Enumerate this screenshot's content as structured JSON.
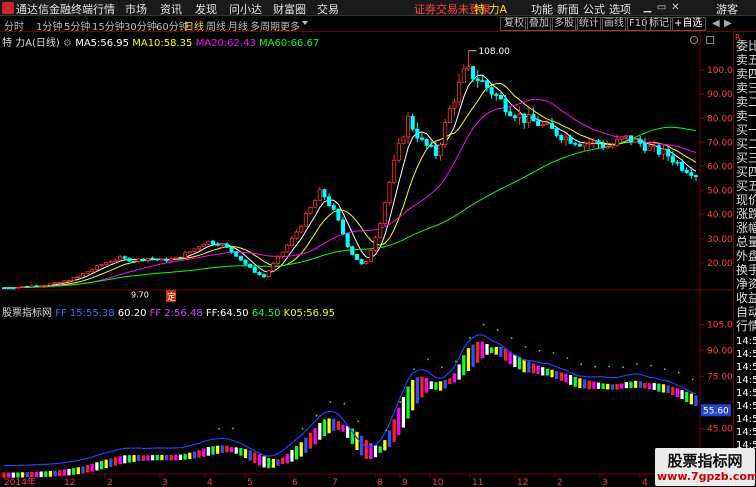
{
  "menubar": {
    "app_title": "通达信金融终端",
    "items": [
      "行情",
      "市场",
      "资讯",
      "发现",
      "问小达",
      "财富圈",
      "交易"
    ],
    "notice": "证劵交易未登录",
    "notice_stock": "特 力A",
    "right_items": [
      "功能",
      "新面",
      "公式",
      "选项"
    ],
    "guest": "游客"
  },
  "periodbar": {
    "periods": [
      "分时",
      "1分钟",
      "5分钟",
      "15分钟",
      "30分钟",
      "60分钟",
      "日线",
      "周线",
      "月线",
      "多周期",
      "更多"
    ],
    "active_period": "日线",
    "tools": [
      "复权",
      "叠加",
      "多股",
      "统计",
      "画线",
      "F10",
      "标记"
    ],
    "self_select": "+自选"
  },
  "main_legend": {
    "name": "特 力A",
    "period": "(日线)",
    "ma5_label": "MA5:",
    "ma5": "56.95",
    "ma10_label": "MA10:",
    "ma10": "58.35",
    "ma20_label": "MA20:",
    "ma20": "62.43",
    "ma60_label": "MA60:",
    "ma60": "66.67"
  },
  "indicator_legend": {
    "name": "股票指标网",
    "fa_label": "FF 15:",
    "fa": "55.38",
    "v1": "60.20",
    "fb_label": "FF 2:",
    "fb": "56.48",
    "ff_label": "FF:",
    "ff": "64.50",
    "v2": "64.50",
    "k05_label": "K05:",
    "k05": "56.95"
  },
  "axis": {
    "main_ticks": [
      "100.0",
      "90.00",
      "80.00",
      "70.00",
      "60.00",
      "50.00",
      "40.00",
      "30.00",
      "20.00"
    ],
    "ind_ticks": [
      "105.0",
      "90.00",
      "75.00",
      "55.60",
      "45.00",
      "30.00"
    ],
    "current_ind": "55.60",
    "peak_label": "108.00",
    "low_label": "9.70",
    "event_marker": "定",
    "date_ticks": [
      "2014年",
      "12",
      "2",
      "3",
      "4",
      "5",
      "6",
      "7",
      "8",
      "9",
      "10",
      "11",
      "12",
      "2",
      "3",
      "4"
    ]
  },
  "right_panel": {
    "top_badge": "R",
    "labels": [
      "委比",
      "卖五",
      "卖四",
      "卖三",
      "卖二",
      "卖一",
      "买一",
      "买二",
      "买三",
      "买四",
      "买五",
      "现价",
      "涨跌",
      "涨幅",
      "总量",
      "外盘",
      "换手",
      "净资",
      "收益",
      "自动",
      "行情"
    ],
    "times": [
      "14:56",
      "14:56",
      "14:56",
      "14:56",
      "14:56",
      "14:56",
      "14:56",
      "14:56",
      "14:56"
    ]
  },
  "watermark": {
    "title": "股票指标网",
    "url": "www.7gpzb.com"
  },
  "colors": {
    "up": "#ff3030",
    "down": "#00ffff",
    "ma5": "#ffffff",
    "ma10": "#ffff00",
    "ma20": "#ff00ff",
    "ma60": "#00ff00",
    "axis": "#7a0000"
  },
  "chart_data": {
    "type": "candlestick",
    "title": "特 力A (日线)",
    "ylim": [
      10,
      110
    ],
    "x": [
      "2014年",
      "12",
      "2",
      "3",
      "4",
      "5",
      "6",
      "7",
      "8",
      "9",
      "10",
      "11",
      "12",
      "2",
      "3",
      "4"
    ],
    "close": [
      9.7,
      10,
      10.5,
      11,
      12,
      14,
      17,
      20,
      22,
      21,
      22,
      21,
      22,
      25,
      29,
      28,
      24,
      18,
      14,
      22,
      30,
      40,
      50,
      40,
      25,
      18,
      35,
      60,
      80,
      70,
      65,
      85,
      100,
      96,
      90,
      84,
      80,
      78,
      75,
      72,
      70,
      70,
      68,
      72,
      70,
      67,
      65,
      60,
      57
    ],
    "peak": 108.0,
    "low": 9.7,
    "ma": {
      "MA5": 56.95,
      "MA10": 58.35,
      "MA20": 62.43,
      "MA60": 66.67
    },
    "indicator": {
      "name": "股票指标网",
      "ylim": [
        20,
        110
      ],
      "current": 55.6
    }
  }
}
